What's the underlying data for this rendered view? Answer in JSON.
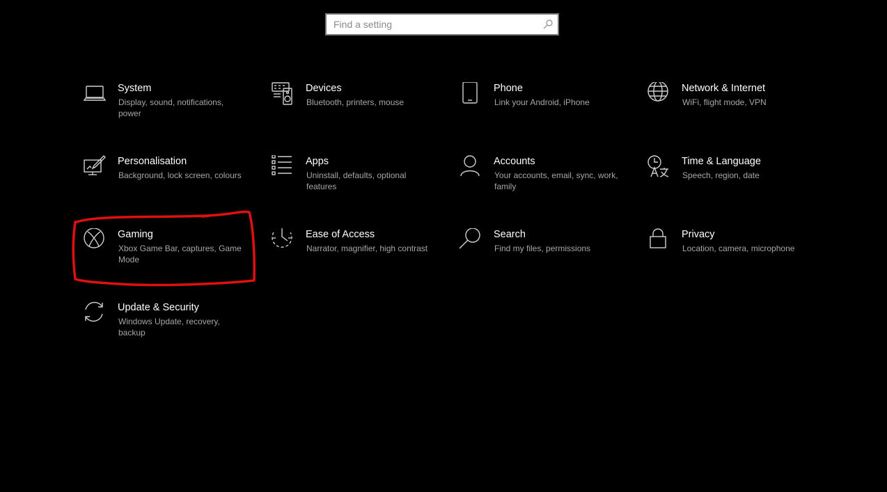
{
  "search": {
    "placeholder": "Find a setting",
    "value": ""
  },
  "tiles": [
    {
      "title": "System",
      "desc": "Display, sound, notifications, power",
      "icon": "laptop-icon"
    },
    {
      "title": "Devices",
      "desc": "Bluetooth, printers, mouse",
      "icon": "keyboard-speaker-icon"
    },
    {
      "title": "Phone",
      "desc": "Link your Android, iPhone",
      "icon": "phone-icon"
    },
    {
      "title": "Network & Internet",
      "desc": "WiFi, flight mode, VPN",
      "icon": "globe-icon"
    },
    {
      "title": "Personalisation",
      "desc": "Background, lock screen, colours",
      "icon": "paint-brush-icon"
    },
    {
      "title": "Apps",
      "desc": "Uninstall, defaults, optional features",
      "icon": "apps-list-icon"
    },
    {
      "title": "Accounts",
      "desc": "Your accounts, email, sync, work, family",
      "icon": "person-icon"
    },
    {
      "title": "Time & Language",
      "desc": "Speech, region, date",
      "icon": "time-language-icon"
    },
    {
      "title": "Gaming",
      "desc": "Xbox Game Bar, captures, Game Mode",
      "icon": "xbox-icon"
    },
    {
      "title": "Ease of Access",
      "desc": "Narrator, magnifier, high contrast",
      "icon": "ease-of-access-icon"
    },
    {
      "title": "Search",
      "desc": "Find my files, permissions",
      "icon": "magnifier-icon"
    },
    {
      "title": "Privacy",
      "desc": "Location, camera, microphone",
      "icon": "lock-icon"
    },
    {
      "title": "Update & Security",
      "desc": "Windows Update, recovery, backup",
      "icon": "sync-arrows-icon"
    }
  ],
  "colors": {
    "background": "#000000",
    "title_text": "#ffffff",
    "desc_text": "#a6a6a6",
    "icon_stroke": "#d0d0d0",
    "annotation": "#e01010"
  }
}
